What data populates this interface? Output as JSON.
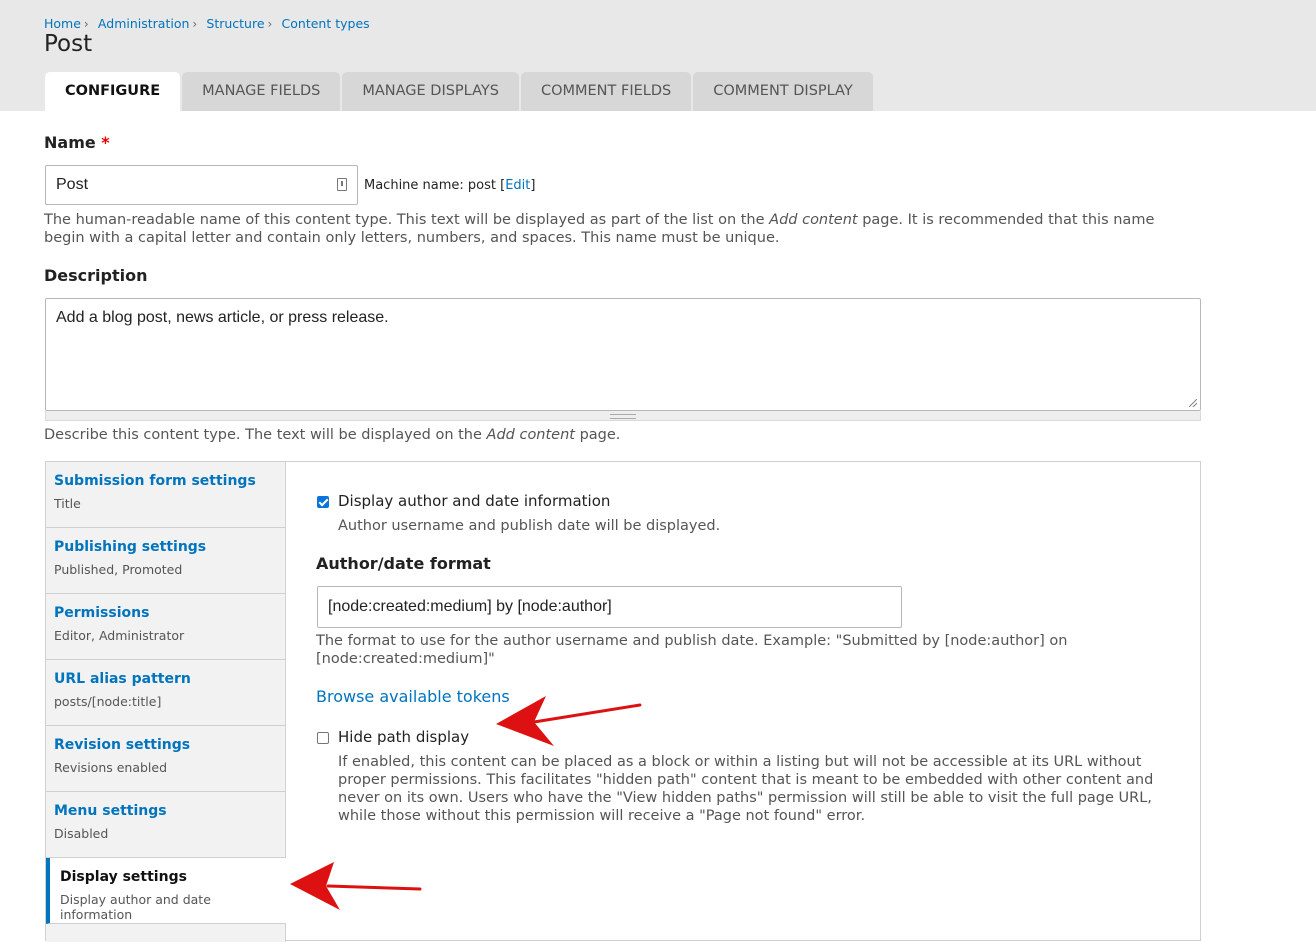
{
  "breadcrumb": [
    "Home",
    "Administration",
    "Structure",
    "Content types"
  ],
  "page_title": "Post",
  "tabs": [
    "Configure",
    "Manage fields",
    "Manage displays",
    "Comment fields",
    "Comment display"
  ],
  "name_field": {
    "label": "Name",
    "required_mark": "*",
    "value": "Post",
    "machine_name_prefix": "Machine name: post [",
    "machine_name_edit": "Edit",
    "machine_name_suffix": "]",
    "help_before": "The human-readable name of this content type. This text will be displayed as part of the list on the ",
    "help_em": "Add content",
    "help_after": " page. It is recommended that this name begin with a capital letter and contain only letters, numbers, and spaces. This name must be unique."
  },
  "description_field": {
    "label": "Description",
    "value": "Add a blog post, news article, or press release.",
    "help_before": "Describe this content type. The text will be displayed on the ",
    "help_em": "Add content",
    "help_after": " page."
  },
  "vertical_tabs": [
    {
      "title": "Submission form settings",
      "summary": "Title"
    },
    {
      "title": "Publishing settings",
      "summary": "Published, Promoted"
    },
    {
      "title": "Permissions",
      "summary": "Editor, Administrator"
    },
    {
      "title": "URL alias pattern",
      "summary": "posts/[node:title]"
    },
    {
      "title": "Revision settings",
      "summary": "Revisions enabled"
    },
    {
      "title": "Menu settings",
      "summary": "Disabled"
    },
    {
      "title": "Display settings",
      "summary": "Display author and date information"
    }
  ],
  "display_settings": {
    "author_checkbox_label": "Display author and date information",
    "author_checkbox_checked": true,
    "author_checkbox_desc": "Author username and publish date will be displayed.",
    "format_label": "Author/date format",
    "format_value": "[node:created:medium] by [node:author]",
    "format_help": "The format to use for the author username and publish date. Example: \"Submitted by [node:author] on [node:created:medium]\"",
    "browse_tokens": "Browse available tokens",
    "hide_path_label": "Hide path display",
    "hide_path_checked": false,
    "hide_path_desc": "If enabled, this content can be placed as a block or within a listing but will not be accessible at its URL without proper permissions. This facilitates \"hidden path\" content that is meant to be embedded with other content and never on its own. Users who have the \"View hidden paths\" permission will still be able to visit the full page URL, while those without this permission will receive a \"Page not found\" error."
  },
  "colors": {
    "link": "#0074bd",
    "header_bg": "#e8e8e8",
    "tab_bg": "#d7d7d7",
    "annotation_arrow": "#dd1111"
  }
}
